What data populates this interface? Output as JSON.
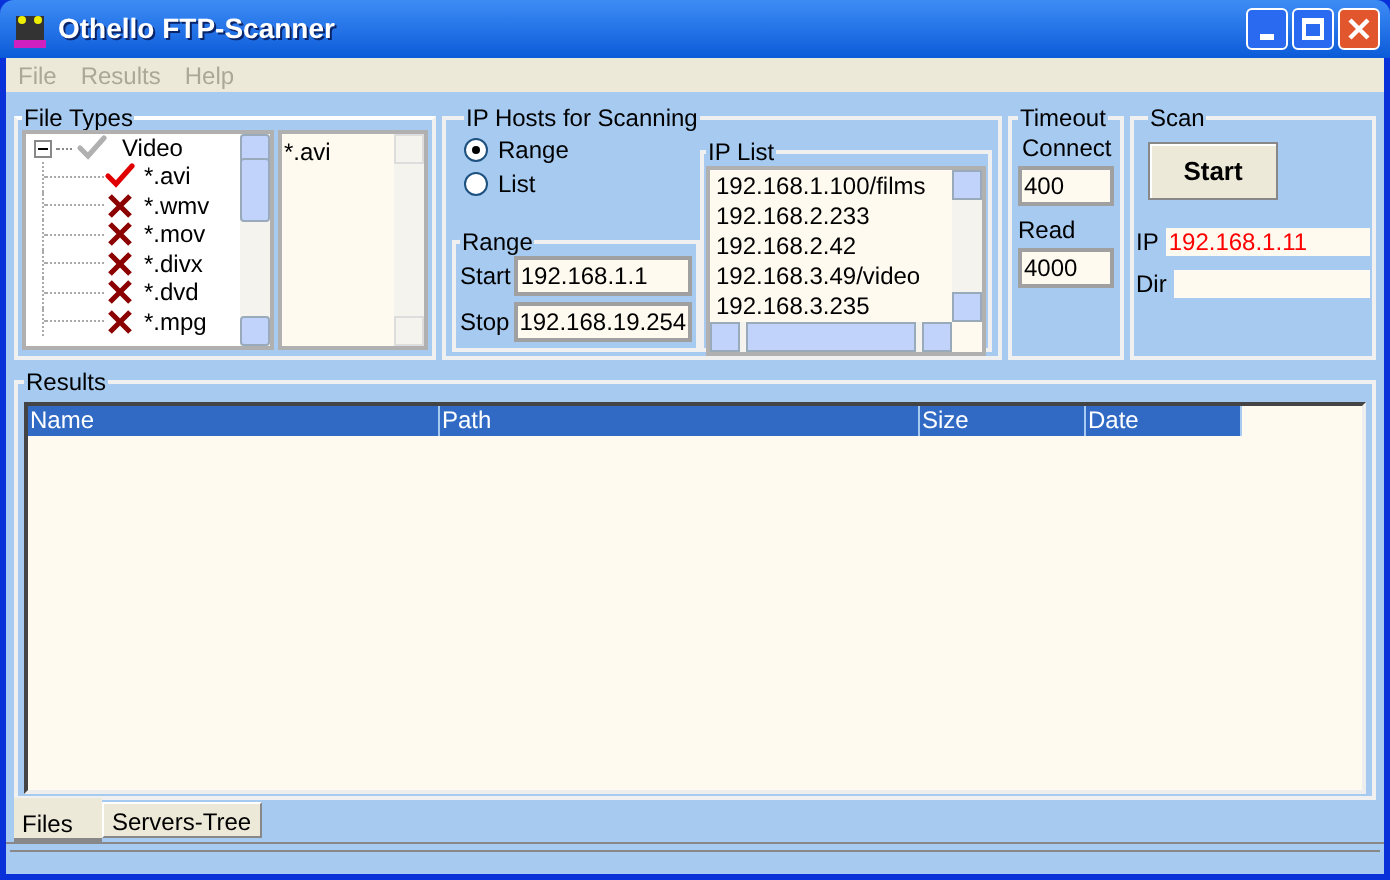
{
  "window": {
    "title": "Othello FTP-Scanner"
  },
  "menu": [
    "File",
    "Results",
    "Help"
  ],
  "file_types": {
    "title": "File Types",
    "tree": [
      {
        "label": "Video",
        "expanded": true,
        "children": [
          {
            "label": "*.avi",
            "checked": true
          },
          {
            "label": "*.wmv",
            "checked": false
          },
          {
            "label": "*.mov",
            "checked": false
          },
          {
            "label": "*.divx",
            "checked": false
          },
          {
            "label": "*.dvd",
            "checked": false
          },
          {
            "label": "*.mpg",
            "checked": false
          }
        ]
      }
    ],
    "selected_list": [
      "*.avi"
    ]
  },
  "ip_hosts": {
    "title": "IP Hosts for Scanning",
    "modes": [
      {
        "label": "Range",
        "selected": true
      },
      {
        "label": "List",
        "selected": false
      }
    ],
    "range": {
      "title": "Range",
      "start_label": "Start",
      "start": "192.168.1.1",
      "stop_label": "Stop",
      "stop": "192.168.19.254"
    },
    "ip_list": {
      "title": "IP List",
      "items": [
        "192.168.1.100/films",
        "192.168.2.233",
        "192.168.2.42",
        "192.168.3.49/video",
        "192.168.3.235"
      ]
    }
  },
  "timeout": {
    "title": "Timeout",
    "connect_label": "Connect",
    "connect": "400",
    "read_label": "Read",
    "read": "4000"
  },
  "scan": {
    "title": "Scan",
    "button": "Start",
    "ip_label": "IP",
    "ip": "192.168.1.11",
    "dir_label": "Dir"
  },
  "results": {
    "title": "Results",
    "columns": [
      "Name",
      "Path",
      "Size",
      "Date"
    ]
  },
  "tabs": [
    {
      "label": "Files",
      "selected": true
    },
    {
      "label": "Servers-Tree",
      "selected": false
    }
  ]
}
